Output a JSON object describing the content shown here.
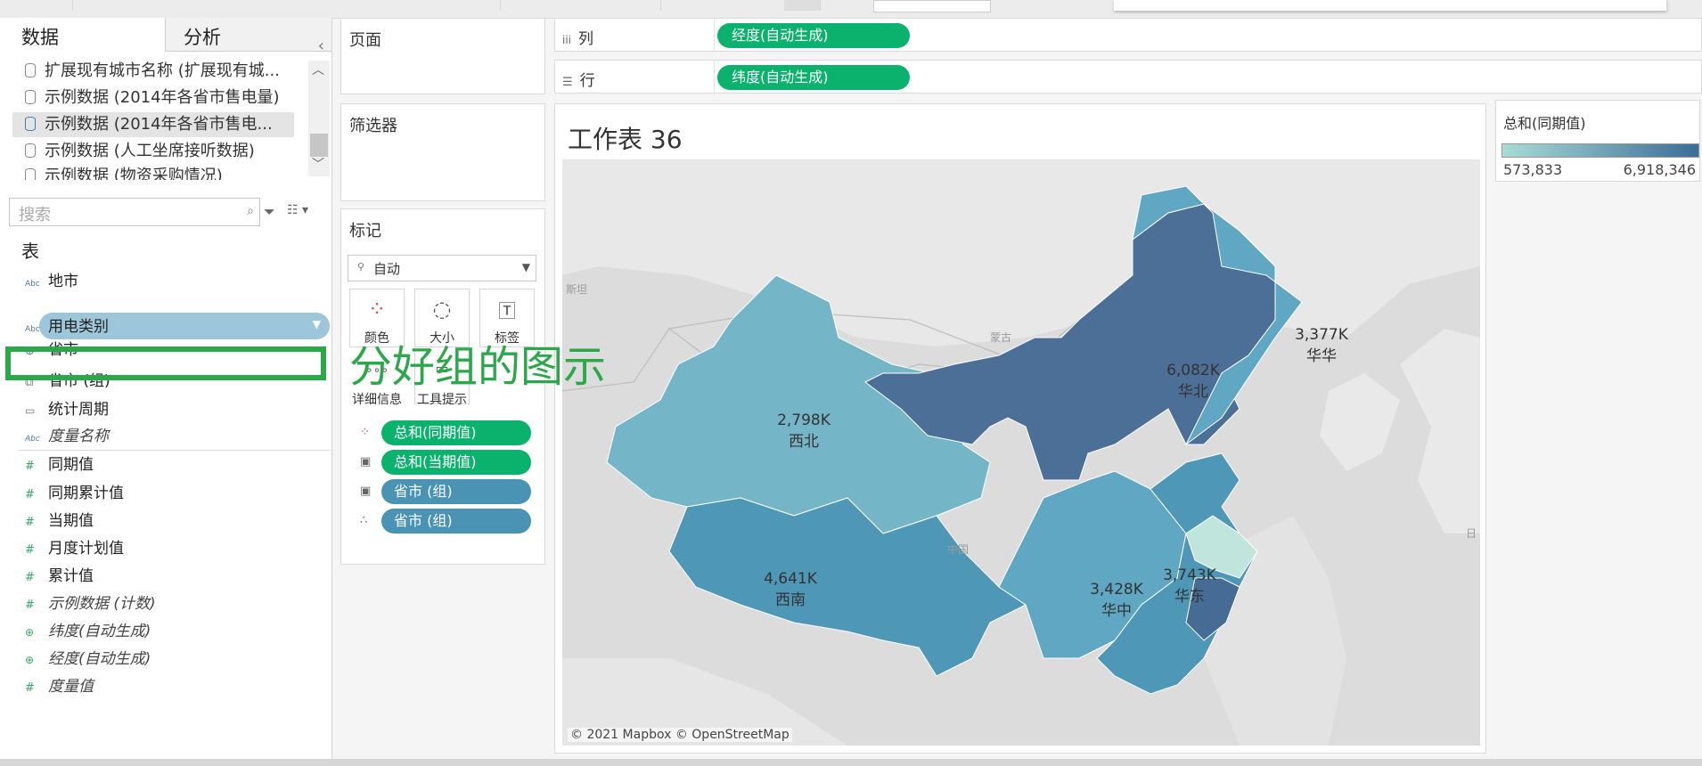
{
  "data_pane": {
    "tabs": [
      "数据",
      "分析"
    ],
    "collapse_icon": "chevron-left-icon",
    "datasources": [
      "扩展现有城市名称 (扩展现有城...",
      "示例数据 (2014年各省市售电量)",
      "示例数据 (2014年各省市售电...",
      "示例数据 (人工坐席接听数据)",
      "示例数据 (物资采购情况)"
    ],
    "search_placeholder": "搜索",
    "table_header": "表",
    "dimensions": [
      {
        "type": "Abc",
        "name": "地市"
      },
      {
        "type": "Abc",
        "name": "用电类别"
      },
      {
        "type": "geo",
        "name": "省市"
      },
      {
        "type": "group",
        "name": "省市 (组)"
      },
      {
        "type": "date",
        "name": "统计周期"
      },
      {
        "type": "Abc",
        "name": "度量名称"
      }
    ],
    "measures": [
      {
        "type": "#",
        "name": "同期值"
      },
      {
        "type": "#",
        "name": "同期累计值"
      },
      {
        "type": "#",
        "name": "当期值"
      },
      {
        "type": "#",
        "name": "月度计划值"
      },
      {
        "type": "#",
        "name": "累计值"
      },
      {
        "type": "#",
        "name": "示例数据 (计数)"
      },
      {
        "type": "geo",
        "name": "纬度(自动生成)"
      },
      {
        "type": "geo",
        "name": "经度(自动生成)"
      },
      {
        "type": "#",
        "name": "度量值"
      }
    ]
  },
  "cards": {
    "pages": "页面",
    "filters": "筛选器",
    "marks": "标记",
    "mark_type": "自动",
    "mark_buttons": [
      "颜色",
      "大小",
      "标签",
      "详细信息",
      "工具提示"
    ],
    "mark_pills": [
      {
        "icon": "color-dots-icon",
        "label": "总和(同期值)",
        "color": "#0bb26e"
      },
      {
        "icon": "text-label-icon",
        "label": "总和(当期值)",
        "color": "#0bb26e"
      },
      {
        "icon": "text-label-icon",
        "label": "省市 (组)",
        "color": "#4a93b4"
      },
      {
        "icon": "detail-dots-icon",
        "label": "省市 (组)",
        "color": "#4a93b4"
      }
    ]
  },
  "shelves": {
    "columns_label": "列",
    "columns_pill": "经度(自动生成)",
    "rows_label": "行",
    "rows_pill": "纬度(自动生成)"
  },
  "sheet": {
    "title": "工作表 36",
    "attribution": "© 2021 Mapbox © OpenStreetMap",
    "base_labels": [
      "斯坦",
      "蒙古",
      "中国",
      "日"
    ]
  },
  "legend": {
    "title": "总和(同期值)",
    "min": "573,833",
    "max": "6,918,346",
    "color_low": "#a9dcd6",
    "color_high": "#3c6c98"
  },
  "annotation": "分好组的图示",
  "chart_data": {
    "type": "filled-map",
    "title": "工作表 36",
    "color_measure": "总和(同期值)",
    "color_range": [
      573833,
      6918346
    ],
    "regions": [
      {
        "name": "西北",
        "label_value": "2,798K"
      },
      {
        "name": "华北",
        "label_value": "6,082K"
      },
      {
        "name": "华华",
        "label_value": "3,377K"
      },
      {
        "name": "西南",
        "label_value": "4,641K"
      },
      {
        "name": "华中",
        "label_value": "3,428K"
      },
      {
        "name": "华东",
        "label_value": "3,743K"
      }
    ]
  }
}
